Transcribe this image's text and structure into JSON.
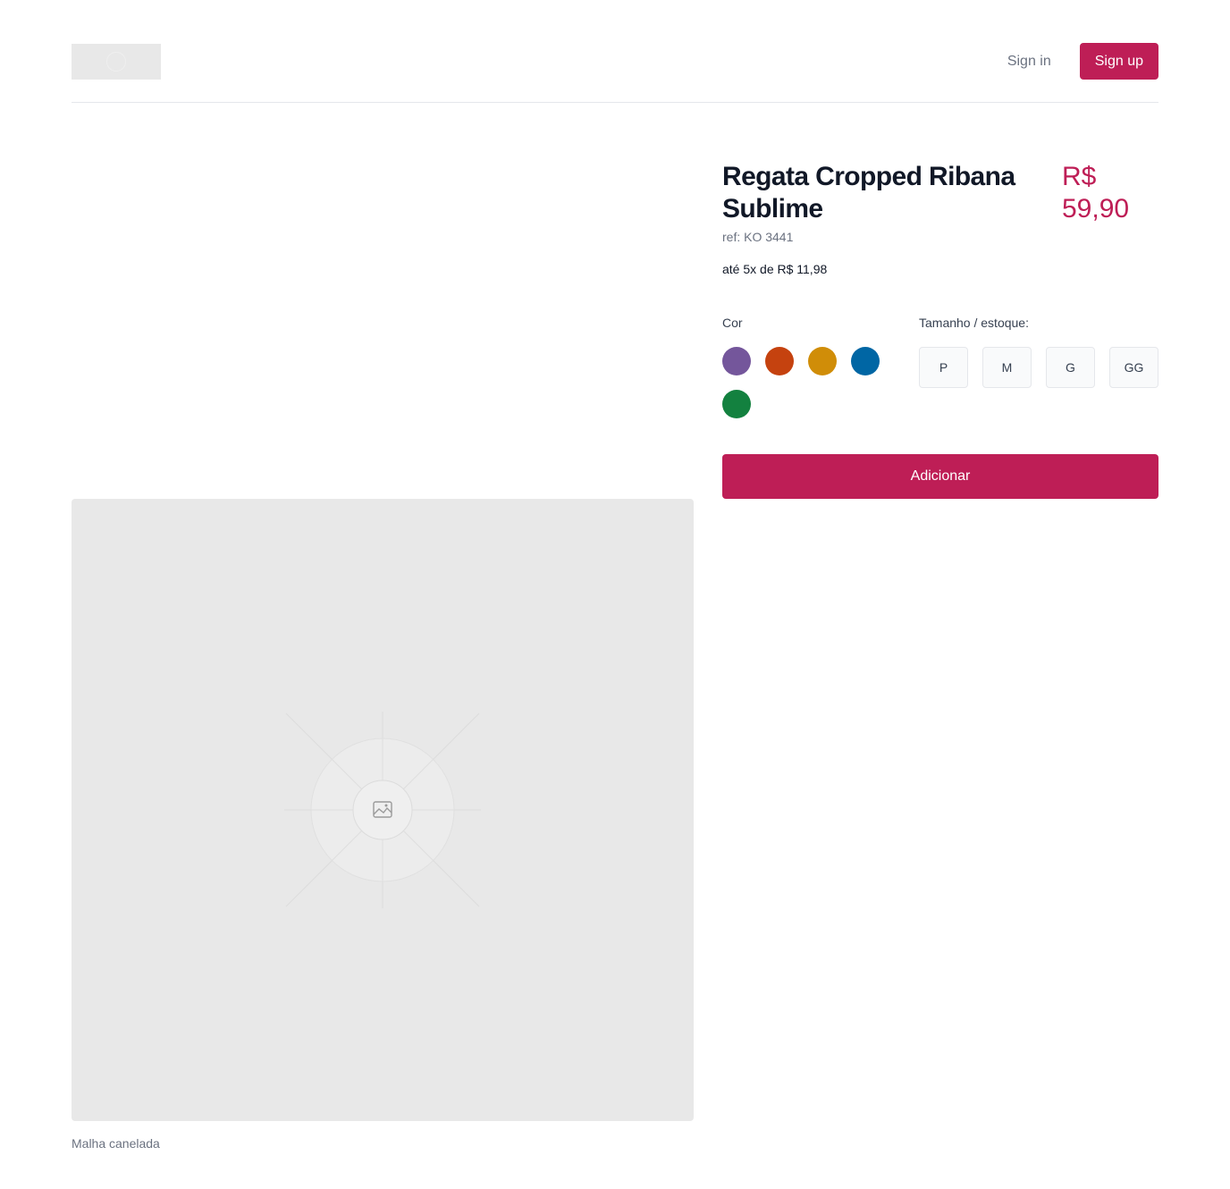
{
  "header": {
    "logo_icon": "logo-placeholder-icon",
    "signin_label": "Sign in",
    "signup_label": "Sign up"
  },
  "product": {
    "title": "Regata Cropped Ribana Sublime",
    "price": "R$ 59,90",
    "ref": "ref: KO 3441",
    "installments": "até 5x de R$ 11,98",
    "image_icon": "image-placeholder-icon",
    "image_caption": "Malha canelada",
    "colors_label": "Cor",
    "colors": [
      {
        "name": "purple",
        "hex": "#74569b"
      },
      {
        "name": "orange",
        "hex": "#c5420f"
      },
      {
        "name": "gold",
        "hex": "#d08d08"
      },
      {
        "name": "blue",
        "hex": "#0066a4"
      },
      {
        "name": "green",
        "hex": "#13813f"
      }
    ],
    "sizes_label": "Tamanho / estoque:",
    "sizes": [
      "P",
      "M",
      "G",
      "GG"
    ],
    "add_label": "Adicionar"
  },
  "theme": {
    "accent": "#be1e56",
    "placeholder_bg": "#e8e8e8"
  }
}
